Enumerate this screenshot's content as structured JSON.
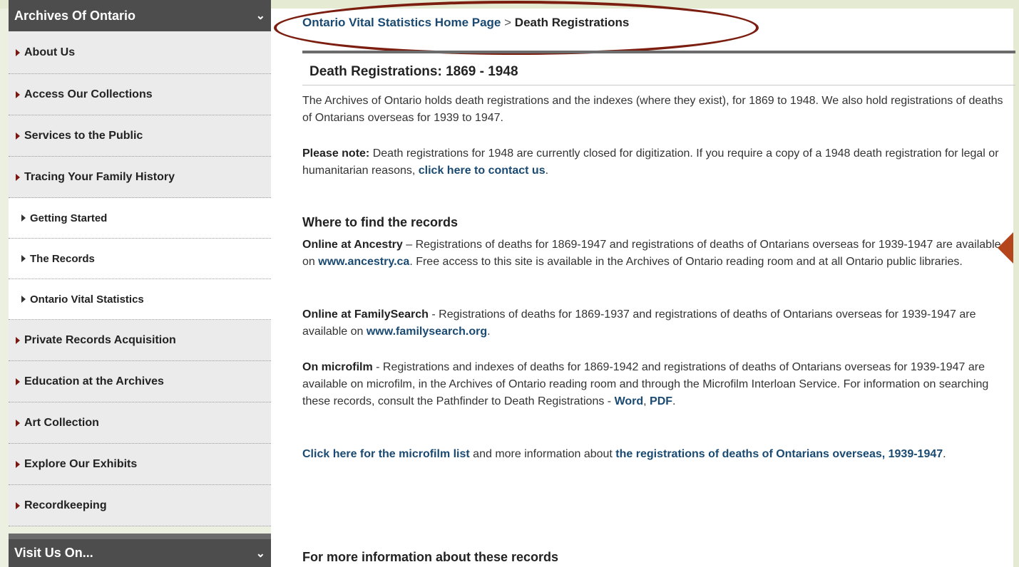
{
  "sidebar": {
    "header": "Archives Of Ontario",
    "items": [
      {
        "label": "About Us"
      },
      {
        "label": "Access Our Collections"
      },
      {
        "label": "Services to the Public"
      },
      {
        "label": "Tracing Your Family History"
      },
      {
        "label": "Getting Started"
      },
      {
        "label": "The Records"
      },
      {
        "label": "Ontario Vital Statistics"
      },
      {
        "label": "Private Records Acquisition"
      },
      {
        "label": "Education at the Archives"
      },
      {
        "label": "Art Collection"
      },
      {
        "label": "Explore Our Exhibits"
      },
      {
        "label": "Recordkeeping"
      }
    ],
    "visit_header": "Visit Us On..."
  },
  "breadcrumb": {
    "home": "Ontario Vital Statistics Home Page",
    "separator": ">",
    "current": "Death Registrations"
  },
  "page_title": "Death Registrations: 1869 - 1948",
  "intro": "The Archives of Ontario holds death registrations and the indexes (where they exist), for 1869 to 1948. We also hold registrations of deaths of Ontarians overseas for 1939 to 1947.",
  "note": {
    "label": "Please note:",
    "text": " Death registrations for 1948 are currently closed for digitization.  If you require a copy of a 1948 death registration for legal or humanitarian reasons,  ",
    "link": "click here to contact us",
    "end": "."
  },
  "where_heading": "Where to find the records",
  "ancestry": {
    "label": "Online at Ancestry",
    "text1": " – Registrations of deaths for 1869-1947 and registrations of deaths of Ontarians overseas for 1939-1947 are available on ",
    "link": "www.ancestry.ca",
    "text2": ".  Free access to this site is available in the Archives of Ontario reading room and at all Ontario public libraries."
  },
  "familysearch": {
    "label": "Online at FamilySearch",
    "text1": " - Registrations of deaths for 1869-1937 and registrations of deaths of Ontarians overseas for 1939-1947 are available on ",
    "link": "www.familysearch.org",
    "text2": "."
  },
  "microfilm": {
    "label": "On microfilm",
    "text1": " - Registrations and indexes of deaths for 1869-1942 and registrations of deaths of Ontarians overseas for 1939-1947 are available on microfilm, in the Archives of Ontario reading room and through the Microfilm Interloan Service. For information on searching these records, consult the Pathfinder to Death Registrations - ",
    "link_word": "Word",
    "comma": ", ",
    "link_pdf": "PDF",
    "end": "."
  },
  "microfilm_list": {
    "link1": "Click here for the microfilm list",
    "text": " and more information about ",
    "link2": "the registrations of deaths of Ontarians overseas, 1939-1947",
    "end": "."
  },
  "more_heading": "For more information about these records",
  "colors": {
    "sidebar_header": "#4d4d4d",
    "link": "#1a4a72",
    "oval": "#7b1e10",
    "bullet": "#7a1711"
  }
}
